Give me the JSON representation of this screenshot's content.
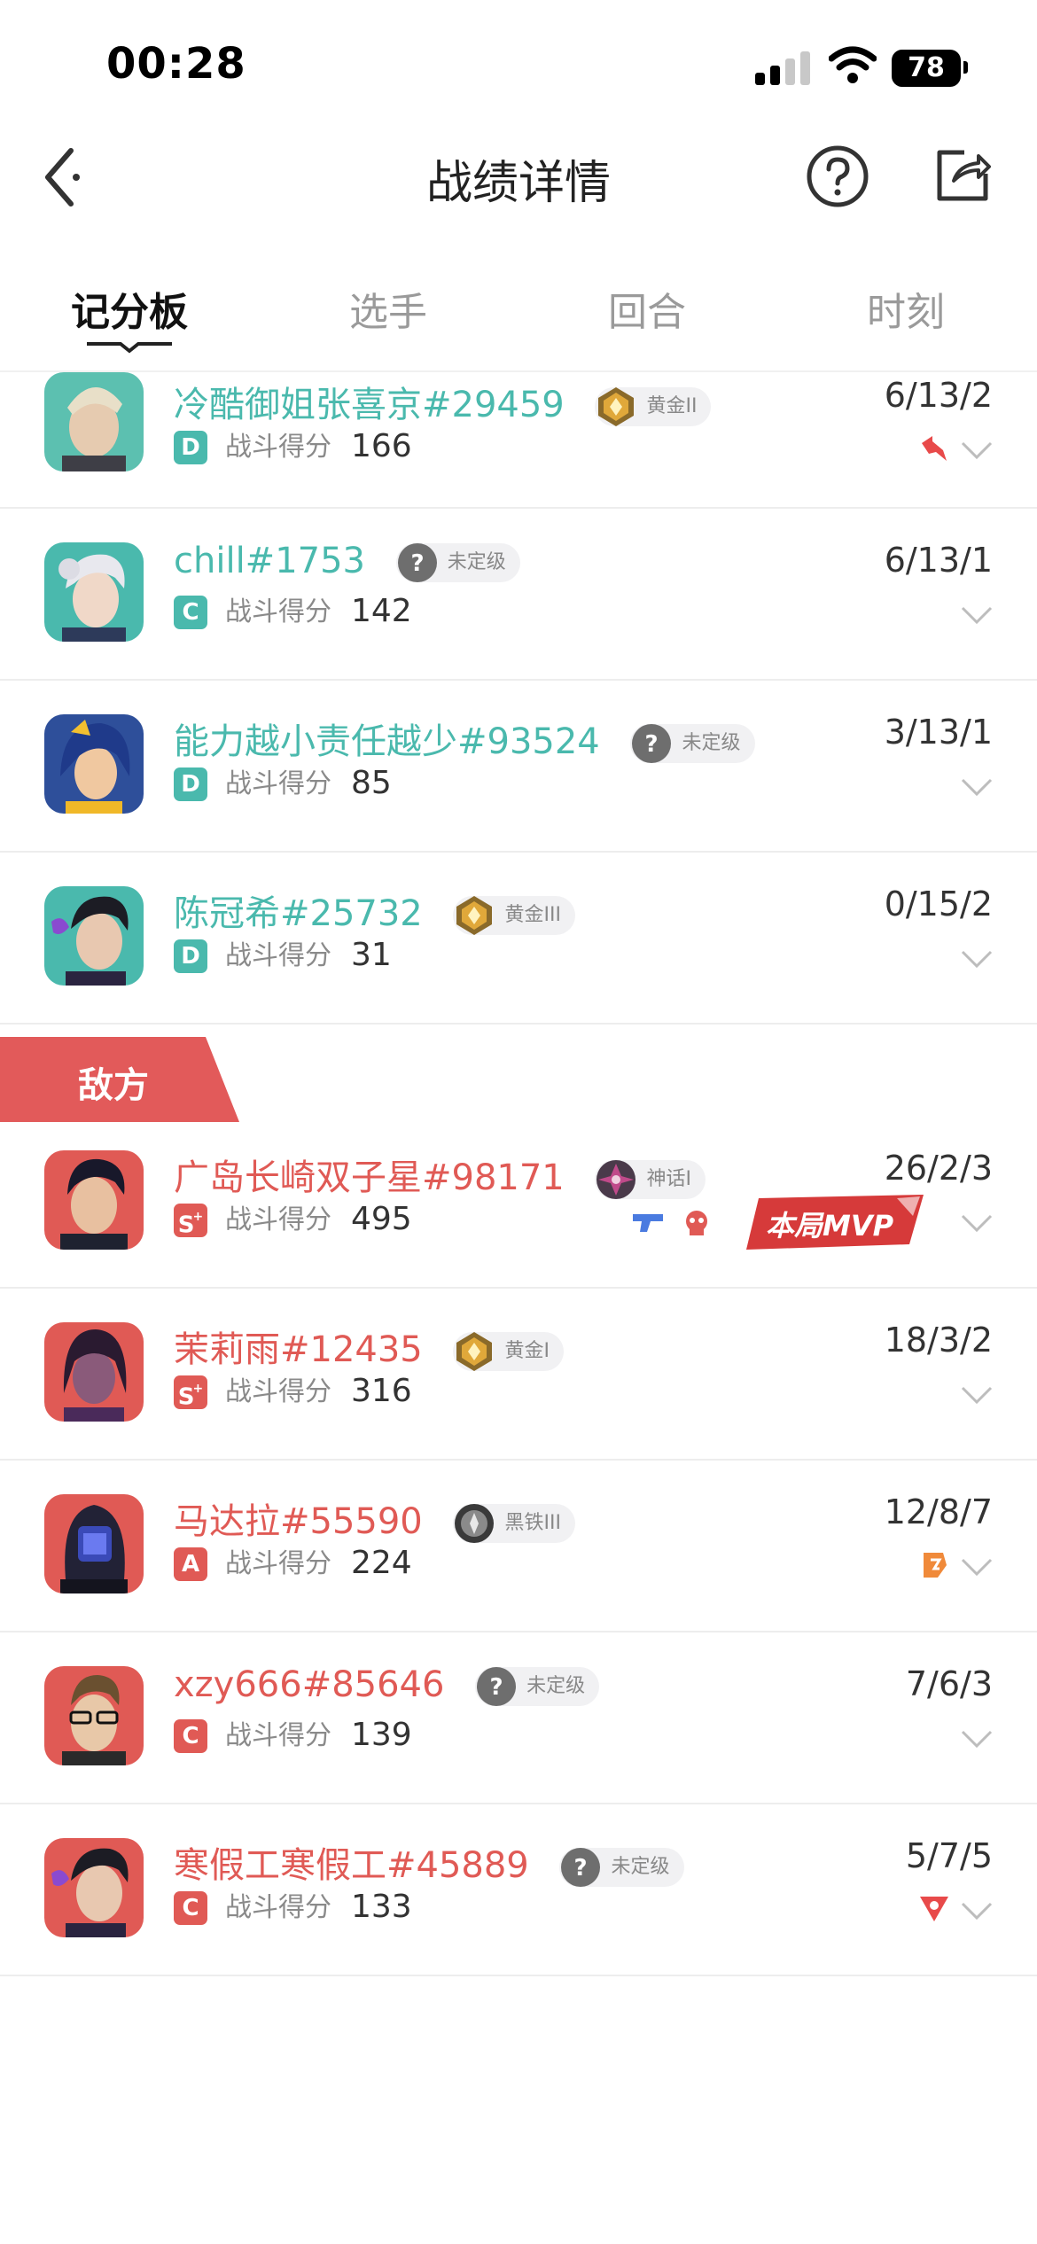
{
  "status_bar": {
    "time": "00:28",
    "battery": "78"
  },
  "nav": {
    "title": "战绩详情"
  },
  "tabs": [
    "记分板",
    "选手",
    "回合",
    "时刻"
  ],
  "score_label": "战斗得分",
  "allies": [
    {
      "name": "冷酷御姐张喜京#29459",
      "rank": "黄金II",
      "grade": "D",
      "score": "166",
      "kda": "6/13/2",
      "medal": "red-arrows"
    },
    {
      "name": "chill#1753",
      "rank": "未定级",
      "grade": "C",
      "score": "142",
      "kda": "6/13/1"
    },
    {
      "name": "能力越小责任越少#93524",
      "rank": "未定级",
      "grade": "D",
      "score": "85",
      "kda": "3/13/1"
    },
    {
      "name": "陈冠希#25732",
      "rank": "黄金III",
      "grade": "D",
      "score": "31",
      "kda": "0/15/2"
    }
  ],
  "enemy_section": {
    "label": "敌方"
  },
  "enemies": [
    {
      "name": "广岛长崎双子星#98171",
      "rank": "神话I",
      "grade": "S",
      "grade_sup": "+",
      "score": "495",
      "kda": "26/2/3",
      "mvp": "本局MVP"
    },
    {
      "name": "茉莉雨#12435",
      "rank": "黄金I",
      "grade": "S",
      "grade_sup": "+",
      "score": "316",
      "kda": "18/3/2"
    },
    {
      "name": "马达拉#55590",
      "rank": "黑铁III",
      "grade": "A",
      "score": "224",
      "kda": "12/8/7",
      "medal": "orange-badge"
    },
    {
      "name": "xzy666#85646",
      "rank": "未定级",
      "grade": "C",
      "score": "139",
      "kda": "7/6/3"
    },
    {
      "name": "寒假工寒假工#45889",
      "rank": "未定级",
      "grade": "C",
      "score": "133",
      "kda": "5/7/5",
      "medal": "red-triangle"
    }
  ],
  "colors": {
    "ally": "#4ab9ad",
    "enemy": "#e05a55"
  }
}
